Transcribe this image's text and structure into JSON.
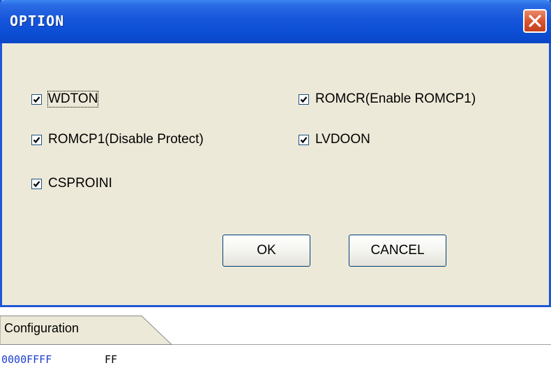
{
  "dialog": {
    "title": "OPTION",
    "options": [
      {
        "label": "WDTON",
        "checked": true
      },
      {
        "label": "ROMCR(Enable ROMCP1)",
        "checked": true
      },
      {
        "label": "ROMCP1(Disable Protect)",
        "checked": true
      },
      {
        "label": "LVDOON",
        "checked": true
      },
      {
        "label": "CSPROINI",
        "checked": true
      }
    ],
    "ok_label": "OK",
    "cancel_label": "CANCEL"
  },
  "bottom": {
    "tab_label": "Configuration",
    "address": "0000FFFF",
    "value": "FF"
  },
  "colors": {
    "titlebar": "#0d4fd6",
    "dialog_bg": "#ece9d8",
    "close_button": "#d95631",
    "address_text": "#1f3fd0"
  },
  "icons": {
    "close": "close-x-icon",
    "check": "checkmark-icon"
  }
}
